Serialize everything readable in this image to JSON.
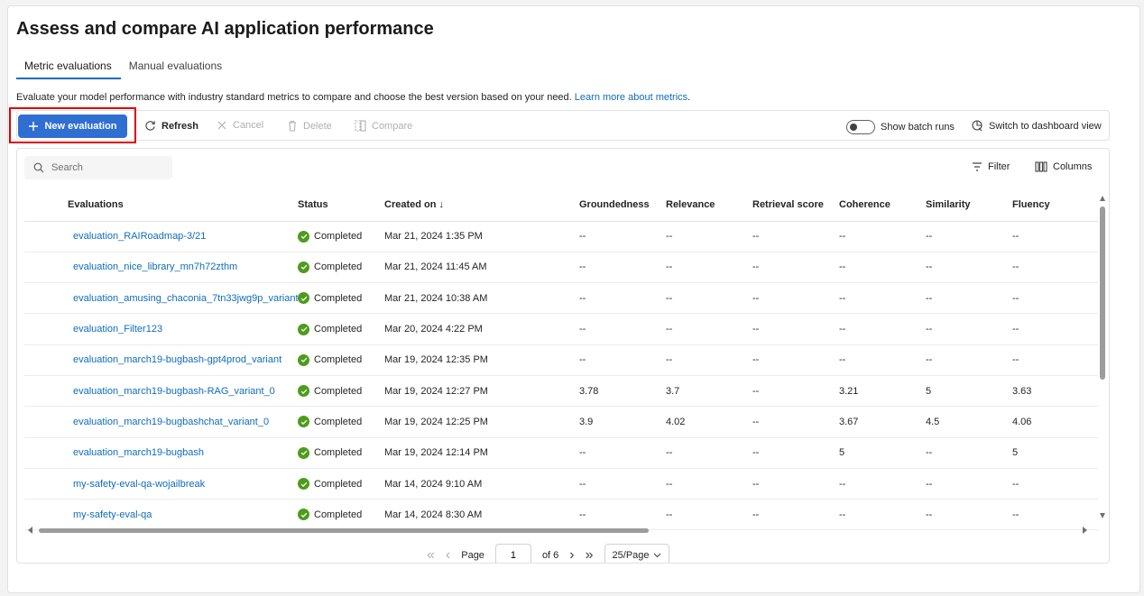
{
  "page": {
    "title": "Assess and compare AI application performance",
    "tabs": [
      {
        "label": "Metric evaluations",
        "active": true
      },
      {
        "label": "Manual evaluations",
        "active": false
      }
    ],
    "description": "Evaluate your model performance with industry standard metrics to compare and choose the best version based on your need.",
    "learn_more": "Learn more about metrics",
    "description_end": "."
  },
  "toolbar": {
    "new_evaluation": "New evaluation",
    "refresh": "Refresh",
    "cancel": "Cancel",
    "delete": "Delete",
    "compare": "Compare",
    "show_batch_runs": "Show batch runs",
    "switch_dashboard": "Switch to dashboard view"
  },
  "grid": {
    "search_placeholder": "Search",
    "filter": "Filter",
    "columns_btn": "Columns",
    "headers": [
      "Evaluations",
      "Status",
      "Created on ↓",
      "Groundedness",
      "Relevance",
      "Retrieval score",
      "Coherence",
      "Similarity",
      "Fluency"
    ],
    "rows": [
      {
        "name": "evaluation_RAIRoadmap-3/21",
        "status": "Completed",
        "created": "Mar 21, 2024 1:35 PM",
        "groundedness": "--",
        "relevance": "--",
        "retrieval": "--",
        "coherence": "--",
        "similarity": "--",
        "fluency": "--"
      },
      {
        "name": "evaluation_nice_library_mn7h72zthm",
        "status": "Completed",
        "created": "Mar 21, 2024 11:45 AM",
        "groundedness": "--",
        "relevance": "--",
        "retrieval": "--",
        "coherence": "--",
        "similarity": "--",
        "fluency": "--"
      },
      {
        "name": "evaluation_amusing_chaconia_7tn33jwg9p_variant",
        "status": "Completed",
        "created": "Mar 21, 2024 10:38 AM",
        "groundedness": "--",
        "relevance": "--",
        "retrieval": "--",
        "coherence": "--",
        "similarity": "--",
        "fluency": "--"
      },
      {
        "name": "evaluation_Filter123",
        "status": "Completed",
        "created": "Mar 20, 2024 4:22 PM",
        "groundedness": "--",
        "relevance": "--",
        "retrieval": "--",
        "coherence": "--",
        "similarity": "--",
        "fluency": "--"
      },
      {
        "name": "evaluation_march19-bugbash-gpt4prod_variant",
        "status": "Completed",
        "created": "Mar 19, 2024 12:35 PM",
        "groundedness": "--",
        "relevance": "--",
        "retrieval": "--",
        "coherence": "--",
        "similarity": "--",
        "fluency": "--"
      },
      {
        "name": "evaluation_march19-bugbash-RAG_variant_0",
        "status": "Completed",
        "created": "Mar 19, 2024 12:27 PM",
        "groundedness": "3.78",
        "relevance": "3.7",
        "retrieval": "--",
        "coherence": "3.21",
        "similarity": "5",
        "fluency": "3.63"
      },
      {
        "name": "evaluation_march19-bugbashchat_variant_0",
        "status": "Completed",
        "created": "Mar 19, 2024 12:25 PM",
        "groundedness": "3.9",
        "relevance": "4.02",
        "retrieval": "--",
        "coherence": "3.67",
        "similarity": "4.5",
        "fluency": "4.06"
      },
      {
        "name": "evaluation_march19-bugbash",
        "status": "Completed",
        "created": "Mar 19, 2024 12:14 PM",
        "groundedness": "--",
        "relevance": "--",
        "retrieval": "--",
        "coherence": "5",
        "similarity": "--",
        "fluency": "5"
      },
      {
        "name": "my-safety-eval-qa-wojailbreak",
        "status": "Completed",
        "created": "Mar 14, 2024 9:10 AM",
        "groundedness": "--",
        "relevance": "--",
        "retrieval": "--",
        "coherence": "--",
        "similarity": "--",
        "fluency": "--"
      },
      {
        "name": "my-safety-eval-qa",
        "status": "Completed",
        "created": "Mar 14, 2024 8:30 AM",
        "groundedness": "--",
        "relevance": "--",
        "retrieval": "--",
        "coherence": "--",
        "similarity": "--",
        "fluency": "--"
      }
    ]
  },
  "pager": {
    "page_label": "Page",
    "page_value": "1",
    "of_label": "of 6",
    "per_page": "25/Page"
  },
  "colors": {
    "accent": "#2f6fd1",
    "link": "#0f6cbd",
    "success": "#4f9b1e",
    "highlight": "#e00000"
  }
}
